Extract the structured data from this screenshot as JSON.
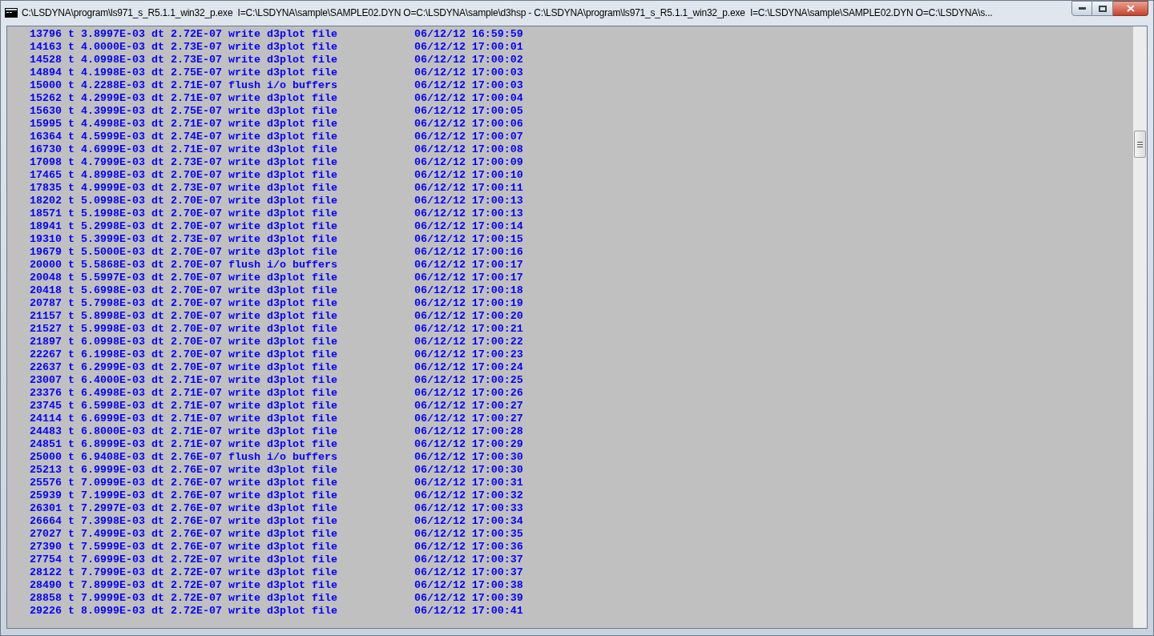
{
  "window": {
    "title": "C:\\LSDYNA\\program\\ls971_s_R5.1.1_win32_p.exe  I=C:\\LSDYNA\\sample\\SAMPLE02.DYN O=C:\\LSDYNA\\sample\\d3hsp - C:\\LSDYNA\\program\\ls971_s_R5.1.1_win32_p.exe  I=C:\\LSDYNA\\sample\\SAMPLE02.DYN O=C:\\LSDYNA\\s..."
  },
  "console_lines": [
    "13796 t 3.8997E-03 dt 2.72E-07 write d3plot file            06/12/12 16:59:59",
    "14163 t 4.0000E-03 dt 2.73E-07 write d3plot file            06/12/12 17:00:01",
    "14528 t 4.0998E-03 dt 2.73E-07 write d3plot file            06/12/12 17:00:02",
    "14894 t 4.1998E-03 dt 2.75E-07 write d3plot file            06/12/12 17:00:03",
    "15000 t 4.2288E-03 dt 2.71E-07 flush i/o buffers            06/12/12 17:00:03",
    "15262 t 4.2999E-03 dt 2.71E-07 write d3plot file            06/12/12 17:00:04",
    "15630 t 4.3999E-03 dt 2.75E-07 write d3plot file            06/12/12 17:00:05",
    "15995 t 4.4998E-03 dt 2.71E-07 write d3plot file            06/12/12 17:00:06",
    "16364 t 4.5999E-03 dt 2.74E-07 write d3plot file            06/12/12 17:00:07",
    "16730 t 4.6999E-03 dt 2.71E-07 write d3plot file            06/12/12 17:00:08",
    "17098 t 4.7999E-03 dt 2.73E-07 write d3plot file            06/12/12 17:00:09",
    "17465 t 4.8998E-03 dt 2.70E-07 write d3plot file            06/12/12 17:00:10",
    "17835 t 4.9999E-03 dt 2.73E-07 write d3plot file            06/12/12 17:00:11",
    "18202 t 5.0998E-03 dt 2.70E-07 write d3plot file            06/12/12 17:00:13",
    "18571 t 5.1998E-03 dt 2.70E-07 write d3plot file            06/12/12 17:00:13",
    "18941 t 5.2998E-03 dt 2.70E-07 write d3plot file            06/12/12 17:00:14",
    "19310 t 5.3999E-03 dt 2.73E-07 write d3plot file            06/12/12 17:00:15",
    "19679 t 5.5000E-03 dt 2.70E-07 write d3plot file            06/12/12 17:00:16",
    "20000 t 5.5868E-03 dt 2.70E-07 flush i/o buffers            06/12/12 17:00:17",
    "20048 t 5.5997E-03 dt 2.70E-07 write d3plot file            06/12/12 17:00:17",
    "20418 t 5.6998E-03 dt 2.70E-07 write d3plot file            06/12/12 17:00:18",
    "20787 t 5.7998E-03 dt 2.70E-07 write d3plot file            06/12/12 17:00:19",
    "21157 t 5.8998E-03 dt 2.70E-07 write d3plot file            06/12/12 17:00:20",
    "21527 t 5.9998E-03 dt 2.70E-07 write d3plot file            06/12/12 17:00:21",
    "21897 t 6.0998E-03 dt 2.70E-07 write d3plot file            06/12/12 17:00:22",
    "22267 t 6.1998E-03 dt 2.70E-07 write d3plot file            06/12/12 17:00:23",
    "22637 t 6.2999E-03 dt 2.70E-07 write d3plot file            06/12/12 17:00:24",
    "23007 t 6.4000E-03 dt 2.71E-07 write d3plot file            06/12/12 17:00:25",
    "23376 t 6.4998E-03 dt 2.71E-07 write d3plot file            06/12/12 17:00:26",
    "23745 t 6.5998E-03 dt 2.71E-07 write d3plot file            06/12/12 17:00:27",
    "24114 t 6.6999E-03 dt 2.71E-07 write d3plot file            06/12/12 17:00:27",
    "24483 t 6.8000E-03 dt 2.71E-07 write d3plot file            06/12/12 17:00:28",
    "24851 t 6.8999E-03 dt 2.71E-07 write d3plot file            06/12/12 17:00:29",
    "25000 t 6.9408E-03 dt 2.76E-07 flush i/o buffers            06/12/12 17:00:30",
    "25213 t 6.9999E-03 dt 2.76E-07 write d3plot file            06/12/12 17:00:30",
    "25576 t 7.0999E-03 dt 2.76E-07 write d3plot file            06/12/12 17:00:31",
    "25939 t 7.1999E-03 dt 2.76E-07 write d3plot file            06/12/12 17:00:32",
    "26301 t 7.2997E-03 dt 2.76E-07 write d3plot file            06/12/12 17:00:33",
    "26664 t 7.3998E-03 dt 2.76E-07 write d3plot file            06/12/12 17:00:34",
    "27027 t 7.4999E-03 dt 2.76E-07 write d3plot file            06/12/12 17:00:35",
    "27390 t 7.5999E-03 dt 2.76E-07 write d3plot file            06/12/12 17:00:36",
    "27754 t 7.6999E-03 dt 2.72E-07 write d3plot file            06/12/12 17:00:37",
    "28122 t 7.7999E-03 dt 2.72E-07 write d3plot file            06/12/12 17:00:37",
    "28490 t 7.8999E-03 dt 2.72E-07 write d3plot file            06/12/12 17:00:38",
    "28858 t 7.9999E-03 dt 2.72E-07 write d3plot file            06/12/12 17:00:39",
    "29226 t 8.0999E-03 dt 2.72E-07 write d3plot file            06/12/12 17:00:41"
  ]
}
